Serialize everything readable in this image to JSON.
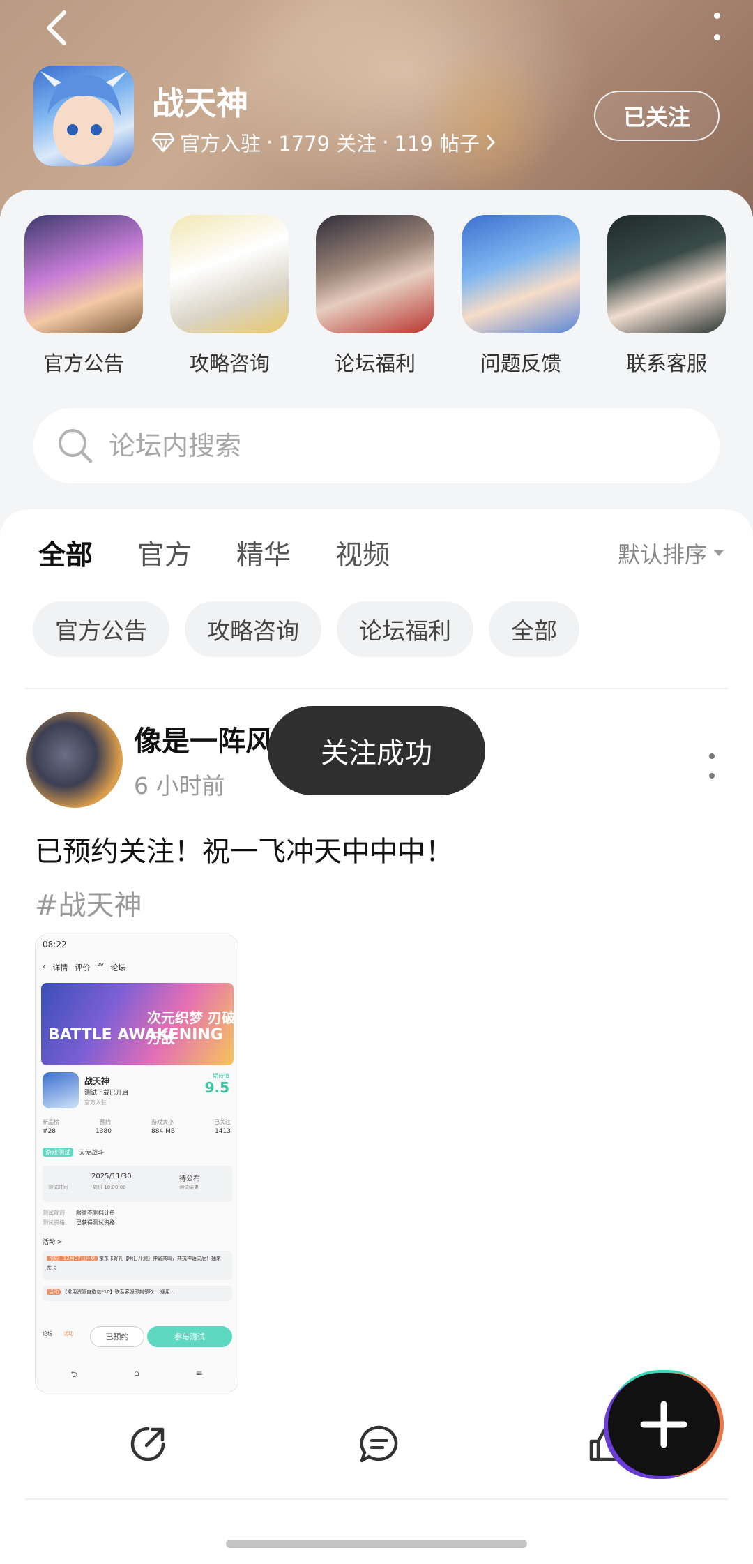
{
  "header": {
    "forum_name": "战天神",
    "verified_label": "官方入驻",
    "followers": "1779 关注",
    "posts": "119 帖子",
    "follow_button": "已关注"
  },
  "shortcuts": [
    {
      "label": "官方公告"
    },
    {
      "label": "攻略咨询"
    },
    {
      "label": "论坛福利"
    },
    {
      "label": "问题反馈"
    },
    {
      "label": "联系客服"
    }
  ],
  "search": {
    "placeholder": "论坛内搜索"
  },
  "tabs": [
    {
      "label": "全部"
    },
    {
      "label": "官方"
    },
    {
      "label": "精华"
    },
    {
      "label": "视频"
    }
  ],
  "sort_label": "默认排序",
  "chips": [
    {
      "label": "官方公告"
    },
    {
      "label": "攻略咨询"
    },
    {
      "label": "论坛福利"
    },
    {
      "label": "全部"
    }
  ],
  "post": {
    "author": "像是一阵风",
    "time": "6 小时前",
    "text": "已预约关注！祝一飞冲天中中中！",
    "tag": "#战天神",
    "screenshot": {
      "status_time": "08:22",
      "tab_detail": "详情",
      "tab_review": "评价",
      "tab_review_count": "29",
      "tab_forum": "论坛",
      "banner_left": "BATTLE AWAKENING",
      "banner_right": "次元织梦 刃破万敌",
      "game_name": "战天神",
      "game_sub": "测试下载已开启",
      "game_verified": "官方入驻",
      "score_label": "期待值",
      "score": "9.5",
      "stats": [
        {
          "label": "新品榜",
          "value": "#28"
        },
        {
          "label": "预约",
          "value": "1380"
        },
        {
          "label": "游戏大小",
          "value": "884 MB"
        },
        {
          "label": "已关注",
          "value": "1413"
        }
      ],
      "test_badge": "游戏测试",
      "test_name": "天使战斗",
      "test_date": "2025/11/30",
      "test_date_sub": "周日 10:00:00",
      "test_time_label": "测试时间",
      "test_end": "待公布",
      "test_end_sub": "测试结束",
      "rule_label": "测试规则",
      "rule_value": "限量不删档计费",
      "qual_label": "测试资格",
      "qual_value": "已获得测试资格",
      "activity_label": "活动 >",
      "activity_1": "京东卡好礼【明日开测】神谕共鸣，共抗神话灾厄！抽京东卡",
      "activity_1_badge": "预约 | 12月07日开奖",
      "activity_2": "【常用资源自选包*10】联系客服即刻领取！ 通用...",
      "activity_2_badge": "活动",
      "bottom_forum": "论坛",
      "bottom_activity": "活动",
      "btn_reserved": "已预约",
      "btn_test": "参与测试"
    }
  },
  "toast": "关注成功",
  "colors": {
    "accent": "#4bd8c0",
    "toast_bg": "#2f2f2f"
  }
}
